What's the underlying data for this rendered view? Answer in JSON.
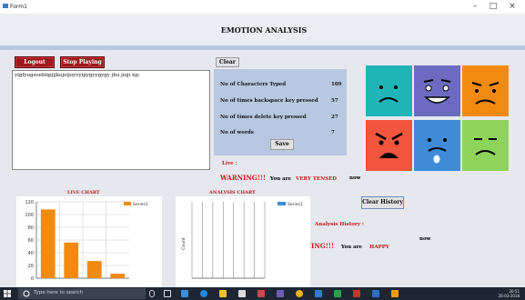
{
  "window": {
    "title": "Form1",
    "minimize": "–",
    "maximize": "□",
    "close": "×"
  },
  "app_title": "EMOTION ANALYSIS",
  "buttons": {
    "logout": "Logout",
    "stop_playing": "Stop Playing",
    "clear": "Clear",
    "save": "Save",
    "clear_history": "Clear History"
  },
  "typed_text": "yigfyugsoebiipjijkojoijoyvyipygyygygy jhu jioji np;",
  "stats": [
    {
      "label": "No of Characters Typed",
      "value": "109"
    },
    {
      "label": "No of times backspace key pressed",
      "value": "57"
    },
    {
      "label": "No of times delete key pressed",
      "value": "27"
    },
    {
      "label": "No of words",
      "value": "7"
    }
  ],
  "live": {
    "label": "Live :",
    "warning": "WARNING!!!",
    "you_are": "You are",
    "emotion": "VERY TENSED",
    "now": "now"
  },
  "history": {
    "label": "Analysis History :",
    "warning": "WARNING!!!",
    "you_are": "You are",
    "emotion": "HAPPY",
    "now": "now"
  },
  "emoji_tiles": [
    {
      "mood": "sad",
      "color": "#1fb5b8",
      "icon": "sad-face-icon"
    },
    {
      "mood": "cheerful",
      "color": "#6c6bc1",
      "icon": "cheerful-face-icon"
    },
    {
      "mood": "upset",
      "color": "#f28a12",
      "icon": "upset-face-icon"
    },
    {
      "mood": "angry",
      "color": "#f1553b",
      "icon": "angry-face-icon"
    },
    {
      "mood": "crying",
      "color": "#3f8bd8",
      "icon": "crying-face-icon"
    },
    {
      "mood": "neutral",
      "color": "#8ed45a",
      "icon": "neutral-face-icon"
    }
  ],
  "taskbar": {
    "search_placeholder": "Type here to search",
    "time": "20:51",
    "date": "26-03-2018"
  },
  "chart_data": [
    {
      "type": "bar",
      "title": "LIVE CHART",
      "series": [
        {
          "name": "Series1",
          "color": "#f28a12",
          "values": [
            108,
            56,
            27,
            7
          ]
        }
      ],
      "categories": [
        "1",
        "2",
        "3",
        "4"
      ],
      "ylim": [
        0,
        120
      ],
      "yticks": [
        0,
        20,
        40,
        60,
        80,
        100,
        120
      ],
      "grid": true,
      "legend": "top-right"
    },
    {
      "type": "bar",
      "title": "ANALYSIS CHART",
      "series": [
        {
          "name": "Series1",
          "color": "#3f8bd8",
          "values": []
        }
      ],
      "ylabel": "Count",
      "grid": true,
      "legend": "top-right"
    }
  ]
}
